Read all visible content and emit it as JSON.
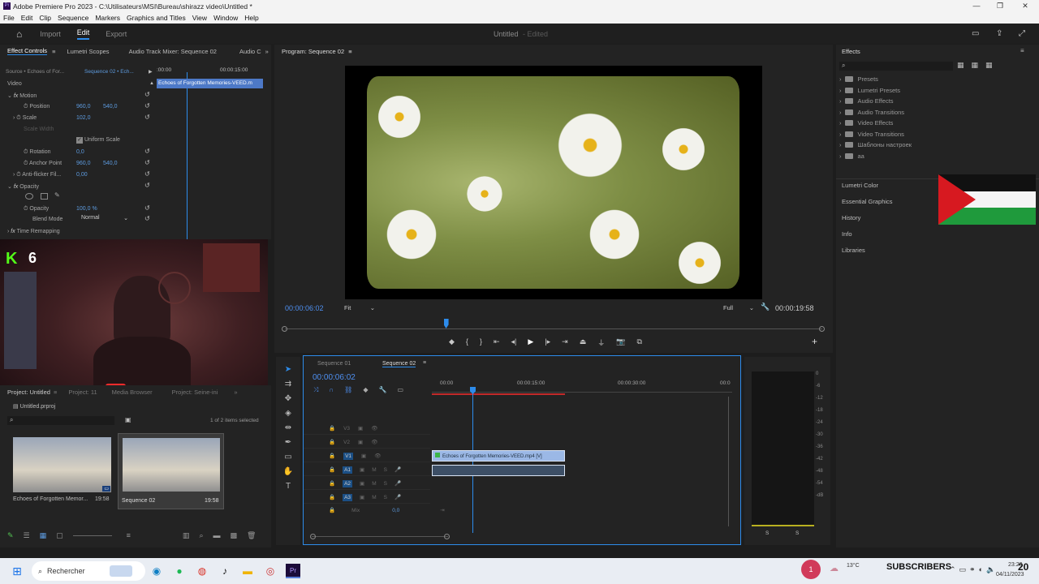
{
  "window": {
    "title": "Adobe Premiere Pro 2023 - C:\\Utilisateurs\\MSI\\Bureau\\shirazz video\\Untitled *",
    "min": "—",
    "max": "❐",
    "close": "✕"
  },
  "menu": [
    "File",
    "Edit",
    "Clip",
    "Sequence",
    "Markers",
    "Graphics and Titles",
    "View",
    "Window",
    "Help"
  ],
  "appbar": {
    "import": "Import",
    "edit": "Edit",
    "export": "Export",
    "project_name": "Untitled",
    "project_status": "- Edited"
  },
  "effect_controls": {
    "tabs": [
      "Effect Controls",
      "Lumetri Scopes",
      "Audio Track Mixer: Sequence 02",
      "Audio C"
    ],
    "source": "Source • Echoes of For...",
    "sequence": "Sequence 02 • Ech...",
    "time_start": ":00:00",
    "time_mid": "00:00:15:00",
    "clip_label": "Echoes of Forgotten Memories-VEED.m",
    "video_label": "Video",
    "motion": "Motion",
    "position_label": "Position",
    "position_x": "960,0",
    "position_y": "540,0",
    "scale_label": "Scale",
    "scale": "102,0",
    "scale_width_label": "Scale Width",
    "uniform_scale": "Uniform Scale",
    "rotation_label": "Rotation",
    "rotation": "0,0",
    "anchor_label": "Anchor Point",
    "anchor_x": "960,0",
    "anchor_y": "540,0",
    "flicker_label": "Anti-flicker Fil...",
    "flicker": "0,00",
    "opacity_group": "Opacity",
    "opacity_label": "Opacity",
    "opacity": "100,0 %",
    "blend_label": "Blend Mode",
    "blend": "Normal",
    "time_remap": "Time Remapping"
  },
  "webcam": {
    "badge_letter": "K",
    "badge_num": "6"
  },
  "program": {
    "tab": "Program: Sequence 02",
    "timecode": "00:00:06:02",
    "fit": "Fit",
    "quality": "Full",
    "duration": "00:00:19:58",
    "playhead_fraction": 0.3
  },
  "project": {
    "tabs": [
      "Project: Untitled",
      "Project: 11",
      "Media Browser",
      "Project: Seine-ini"
    ],
    "file": "Untitled.prproj",
    "selection": "1 of 2 items selected",
    "items": [
      {
        "name": "Echoes of Forgotten Memor...",
        "dur": "19:58"
      },
      {
        "name": "Sequence 02",
        "dur": "19:58"
      }
    ]
  },
  "timeline": {
    "tabs": [
      "Sequence 01",
      "Sequence 02"
    ],
    "timecode": "00:00:06:02",
    "ruler": [
      "00:00",
      "00:00:15:00",
      "00:00:30:00",
      "00:0"
    ],
    "tracks": [
      {
        "id": "V3"
      },
      {
        "id": "V2"
      },
      {
        "id": "V1"
      },
      {
        "id": "A1"
      },
      {
        "id": "A2"
      },
      {
        "id": "A3"
      }
    ],
    "mix_label": "Mix",
    "mix_value": "0,0",
    "video_clip": "Echoes of Forgotten Memories-VEED.mp4 [V]",
    "m": "M",
    "s": "S"
  },
  "meters": {
    "scale": [
      "0",
      "-6",
      "-12",
      "-18",
      "-24",
      "-30",
      "-36",
      "-42",
      "-48",
      "-54",
      "-dB"
    ],
    "s1": "S",
    "s2": "S"
  },
  "effects": {
    "title": "Effects",
    "items": [
      "Presets",
      "Lumetri Presets",
      "Audio Effects",
      "Audio Transitions",
      "Video Effects",
      "Video Transitions",
      "Шаблоны настроек",
      "aa"
    ],
    "panels": [
      "Lumetri Color",
      "Essential Graphics",
      "History",
      "Info",
      "Libraries"
    ]
  },
  "taskbar": {
    "search": "Rechercher",
    "notif": "1",
    "weather": "13°C",
    "subscribers": "SUBSCRIBERS",
    "sub_count": "20",
    "time": "23:20",
    "date": "04/11/2023"
  },
  "colors": {
    "accent": "#2d8ceb",
    "clip_video": "#9bb8e6",
    "timecode_blue": "#4e8ff0"
  }
}
